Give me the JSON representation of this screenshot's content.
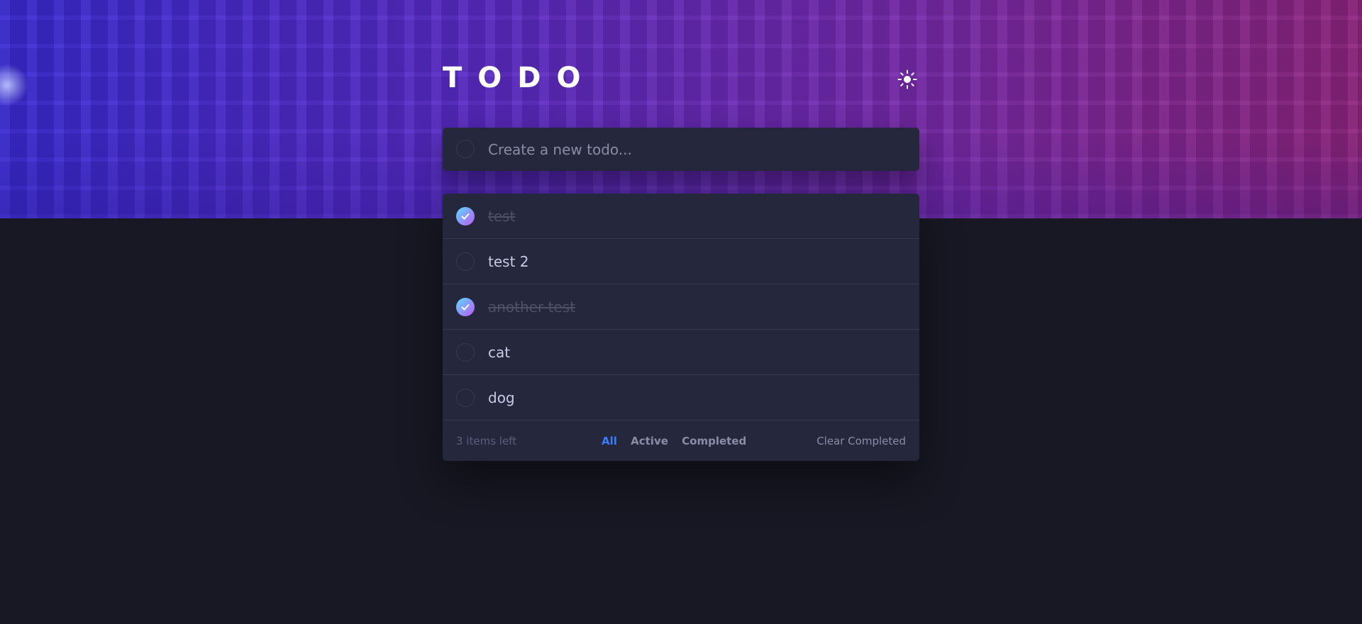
{
  "app": {
    "title": "TODO",
    "theme_icon": "sun-icon"
  },
  "new_todo": {
    "placeholder": "Create a new todo..."
  },
  "todos": [
    {
      "text": "test",
      "completed": true
    },
    {
      "text": "test 2",
      "completed": false
    },
    {
      "text": "another test",
      "completed": true
    },
    {
      "text": "cat",
      "completed": false
    },
    {
      "text": "dog",
      "completed": false
    }
  ],
  "footer": {
    "items_left": "3 items left",
    "filters": [
      "All",
      "Active",
      "Completed"
    ],
    "active_filter": "All",
    "clear_label": "Clear Completed"
  },
  "colors": {
    "accent": "#3a7cfd",
    "card": "#25273c",
    "background": "#181824",
    "check_gradient_start": "#55ddff",
    "check_gradient_end": "#c058f3"
  }
}
